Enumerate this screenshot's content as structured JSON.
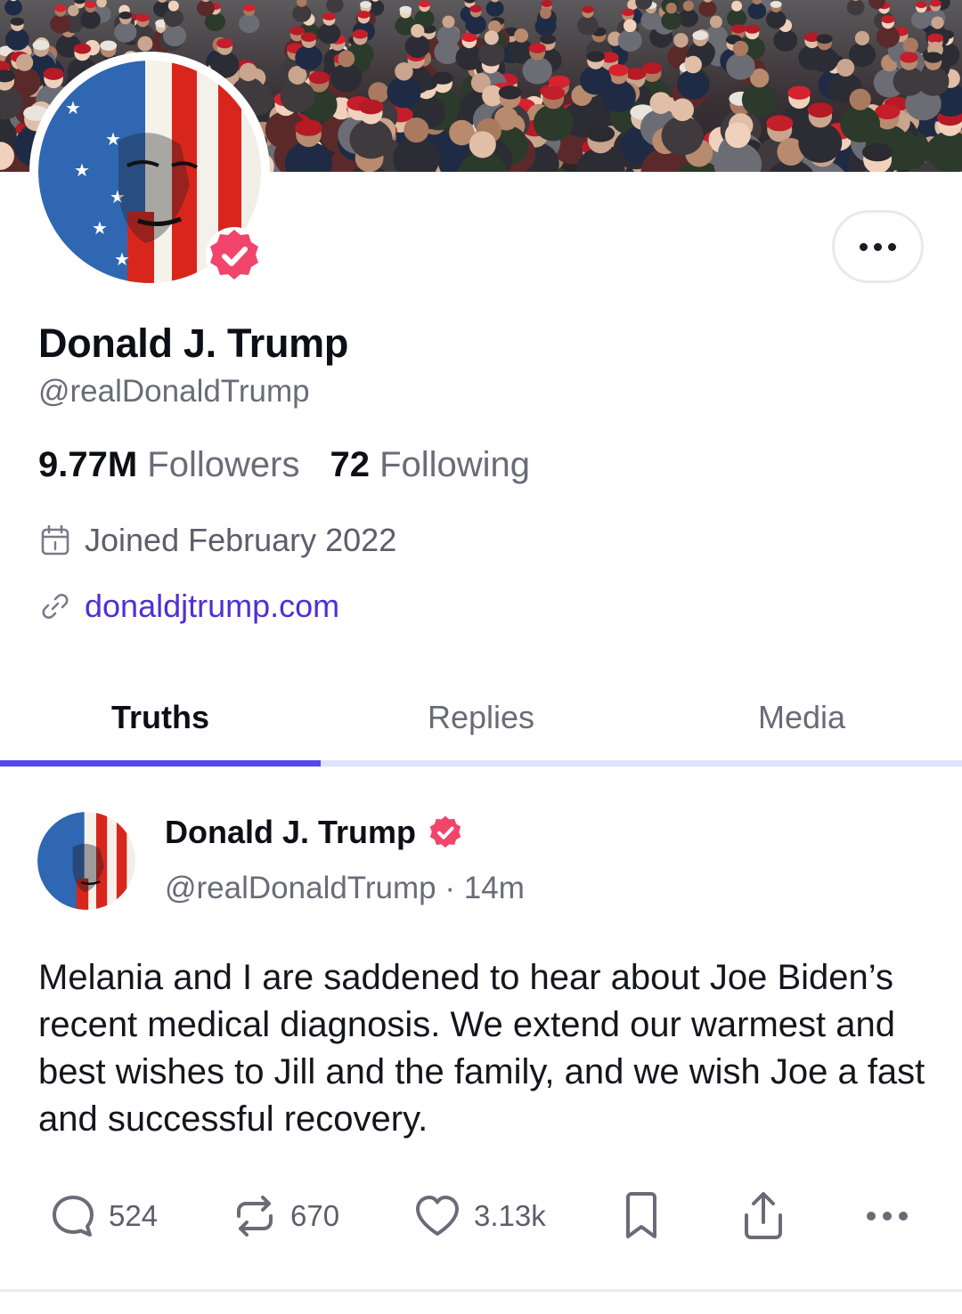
{
  "profile": {
    "display_name": "Donald J. Trump",
    "handle": "@realDonaldTrump",
    "followers_count": "9.77M",
    "followers_label": "Followers",
    "following_count": "72",
    "following_label": "Following",
    "joined": "Joined February 2022",
    "website": "donaldjtrump.com"
  },
  "tabs": [
    {
      "label": "Truths",
      "active": true
    },
    {
      "label": "Replies",
      "active": false
    },
    {
      "label": "Media",
      "active": false
    }
  ],
  "post": {
    "author_name": "Donald J. Trump",
    "author_handle": "@realDonaldTrump",
    "separator": "·",
    "time": "14m",
    "text": "Melania and I are saddened to hear about Joe Biden’s recent medical diagnosis. We extend our warmest and best wishes to Jill and the family, and we wish Joe a fast and successful recovery.",
    "reply_count": "524",
    "repost_count": "670",
    "like_count": "3.13k"
  },
  "icons": {
    "more": "more-horizontal-icon",
    "verified": "verified-badge-icon",
    "calendar": "calendar-icon",
    "link": "link-icon",
    "reply": "comment-icon",
    "repost": "repost-icon",
    "like": "heart-icon",
    "bookmark": "bookmark-icon",
    "share": "share-icon"
  },
  "colors": {
    "accent": "#5448ee",
    "link": "#4f2fd6",
    "verified": "#f1456b",
    "muted": "#6b6b78"
  }
}
